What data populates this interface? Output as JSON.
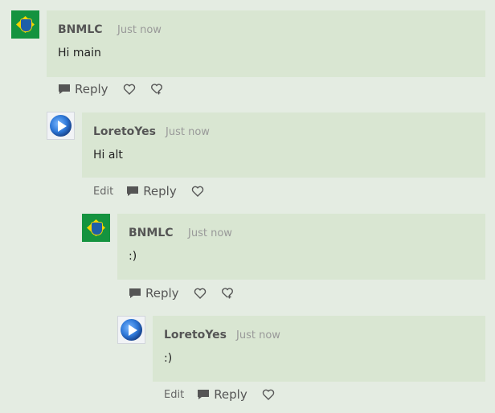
{
  "comments": [
    {
      "author": "BNMLC",
      "time": "Just now",
      "text": "Hi main",
      "reply_label": "Reply",
      "edit_label": ""
    },
    {
      "author": "LoretoYes",
      "time": "Just now",
      "text": "Hi alt",
      "reply_label": "Reply",
      "edit_label": "Edit"
    },
    {
      "author": "BNMLC",
      "time": "Just now",
      "text": ":)",
      "reply_label": "Reply",
      "edit_label": ""
    },
    {
      "author": "LoretoYes",
      "time": "Just now",
      "text": ":)",
      "reply_label": "Reply",
      "edit_label": "Edit"
    }
  ],
  "icons": {
    "reply": "speech-bubble-icon",
    "like": "heart-icon",
    "award": "award-icon",
    "avatar_1": "brazil-empire-flag-avatar",
    "avatar_2": "play-logo-avatar"
  },
  "colors": {
    "background": "#e4ece2",
    "bubble": "#d9e6d2",
    "author": "#555555",
    "timestamp": "#999999"
  }
}
